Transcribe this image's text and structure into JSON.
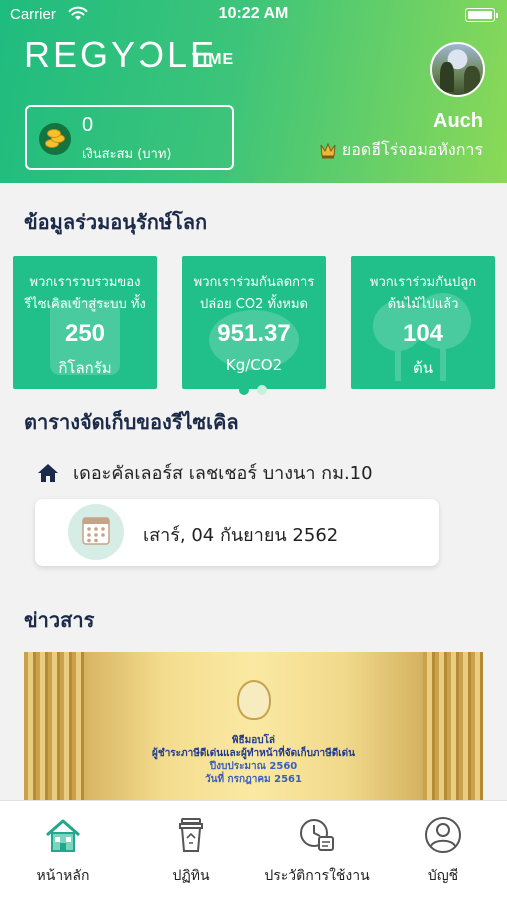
{
  "status_bar": {
    "carrier": "Carrier",
    "time": "10:22 AM"
  },
  "header": {
    "logo_text": "REGYƆLE",
    "logo_sub": "TIME",
    "savings_value": "0",
    "savings_label": "เงินสะสม (บาท)",
    "username": "Auch",
    "rank_label": "ยอดฮีโร่จอมอหังการ"
  },
  "impact": {
    "title": "ข้อมูลร่วมอนุรักษ์โลก",
    "cards": [
      {
        "desc": "พวกเรารวบรวมของรีไซเคิลเข้าสู่ระบบ ทั้งห...",
        "value": "250",
        "unit": "กิโลกรัม"
      },
      {
        "desc": "พวกเราร่วมกันลดการปล่อย CO2 ทั้งหมด",
        "value": "951.37",
        "unit": "Kg/CO2"
      },
      {
        "desc": "พวกเราร่วมกันปลูกต้นไม้ไปแล้ว",
        "value": "104",
        "unit": "ต้น"
      }
    ],
    "active_page": 1,
    "page_count": 2
  },
  "schedule": {
    "title": "ตารางจัดเก็บของรีไซเคิล",
    "location": "เดอะคัลเลอร์ส เลชเชอร์ บางนา กม.10",
    "date": "เสาร์, 04 กันยายน 2562"
  },
  "news": {
    "title": "ข่าวสาร",
    "image_text": [
      "พิธีมอบโล่",
      "ผู้ชำระภาษีดีเด่นและผู้ทำหน้าที่จัดเก็บภาษีดีเด่น",
      "ปีงบประมาณ 2560",
      "วันที่ กรกฎาคม 2561"
    ]
  },
  "tabbar": {
    "items": [
      {
        "label": "หน้าหลัก",
        "icon": "home-icon",
        "active": true
      },
      {
        "label": "ปฏิทิน",
        "icon": "recycle-bin-icon",
        "active": false
      },
      {
        "label": "ประวัติการใช้งาน",
        "icon": "history-clock-icon",
        "active": false
      },
      {
        "label": "บัญชี",
        "icon": "account-icon",
        "active": false
      }
    ]
  },
  "colors": {
    "accent": "#21c08a",
    "title_navy": "#1c2a4a"
  }
}
